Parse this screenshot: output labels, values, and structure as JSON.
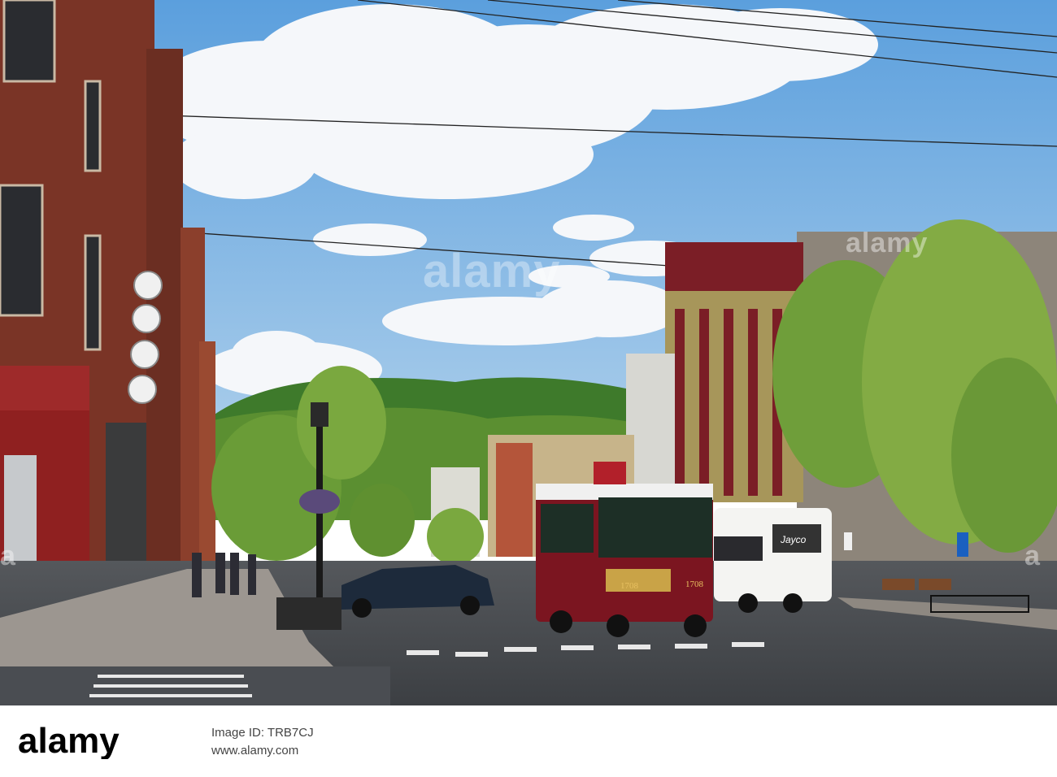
{
  "photo": {
    "trolley_number_front": "1708",
    "trolley_number_side": "1708",
    "rv_brand": "Jayco"
  },
  "watermark": {
    "main": "alamy",
    "small_1": "a",
    "small_2": "a",
    "small_3": "alamy"
  },
  "footer": {
    "logo_text": "alamy",
    "image_id": "Image ID: TRB7CJ",
    "site": "www.alamy.com"
  },
  "colors": {
    "sky": "#6aa6db",
    "brick": "#7a3426",
    "trolley_red": "#7b1520",
    "trolley_green": "#1d2f26",
    "road": "#4a4d52",
    "hill": "#3f7a2a"
  }
}
